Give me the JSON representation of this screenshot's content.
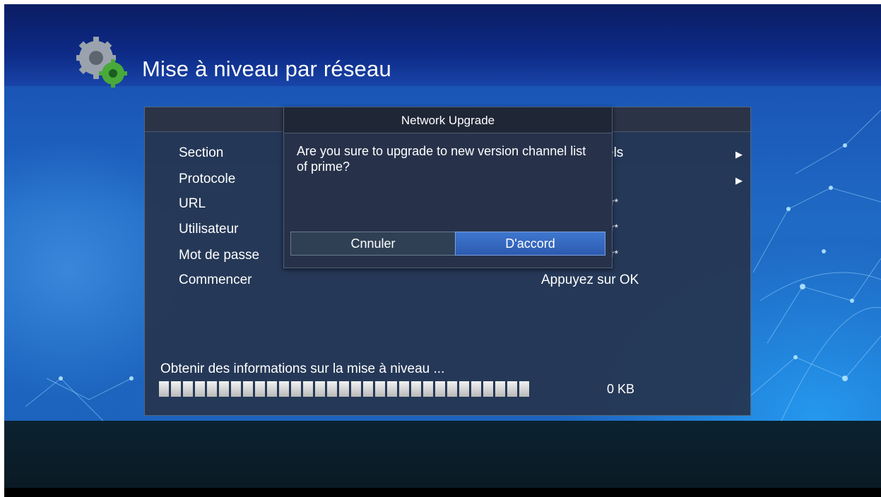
{
  "header": {
    "title": "Mise à niveau par réseau",
    "icon": "gear-icon"
  },
  "settings": {
    "rows": [
      {
        "label": "Section",
        "value": "els"
      },
      {
        "label": "Protocole",
        "value": ""
      },
      {
        "label": "URL",
        "value": "r*"
      },
      {
        "label": "Utilisateur",
        "value": "r*"
      },
      {
        "label": "Mot de passe",
        "value": "r*"
      },
      {
        "label": "Commencer",
        "value": "Appuyez sur OK"
      }
    ]
  },
  "progress": {
    "text": "Obtenir des informations sur la mise à niveau ...",
    "size": "0 KB",
    "segments": 31
  },
  "dialog": {
    "title": "Network Upgrade",
    "message": "Are you sure to upgrade to new version channel list of prime?",
    "cancel_label": "Cnnuler",
    "ok_label": "D'accord",
    "selected": "ok"
  },
  "colors": {
    "accent": "#3a6fc8",
    "panel": "#26344e",
    "dialog": "#27324a"
  }
}
